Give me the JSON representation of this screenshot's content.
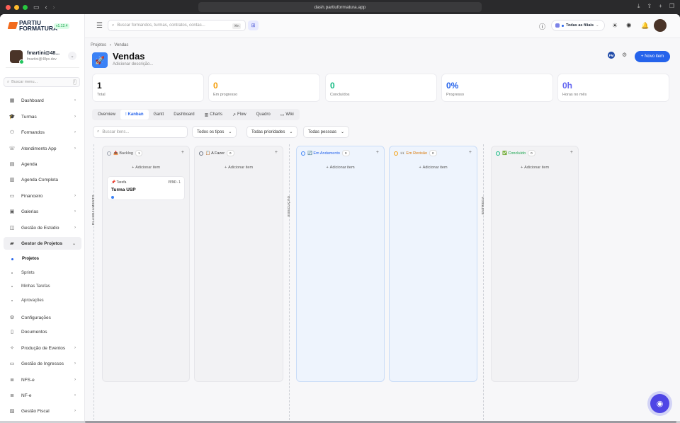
{
  "browser": {
    "url": "dash.partiuformatura.app"
  },
  "brand": {
    "line1": "PARTIU",
    "line2": "FORMATURA",
    "version": "v1.12.4"
  },
  "user": {
    "name": "fmartini@48...",
    "email": "fmartini@48px.dev"
  },
  "sidebar_search": {
    "placeholder": "Buscar menu...",
    "shortcut": "/"
  },
  "nav": [
    {
      "label": "Dashboard",
      "icon": "dashboard-icon",
      "chev": "›"
    },
    {
      "label": "Turmas",
      "icon": "graduation-cap-icon",
      "chev": "›"
    },
    {
      "label": "Formandos",
      "icon": "users-icon",
      "chev": "›"
    },
    {
      "label": "Atendimento App",
      "icon": "headset-icon",
      "chev": "›"
    },
    {
      "label": "Agenda",
      "icon": "calendar-icon",
      "chev": ""
    },
    {
      "label": "Agenda Completa",
      "icon": "calendar-full-icon",
      "chev": ""
    },
    {
      "label": "Financeiro",
      "icon": "wallet-icon",
      "chev": "›"
    },
    {
      "label": "Galerias",
      "icon": "gallery-icon",
      "chev": "›"
    },
    {
      "label": "Gestão de Estúdio",
      "icon": "studio-icon",
      "chev": "›"
    },
    {
      "label": "Gestor de Projetos",
      "icon": "briefcase-icon",
      "chev": "⌄"
    }
  ],
  "subnav": [
    {
      "label": "Projetos",
      "active": true
    },
    {
      "label": "Sprints"
    },
    {
      "label": "Minhas Tarefas"
    },
    {
      "label": "Aprovações"
    }
  ],
  "nav2": [
    {
      "label": "Configurações",
      "icon": "gear-icon",
      "chev": ""
    },
    {
      "label": "Documentos",
      "icon": "document-icon",
      "chev": ""
    },
    {
      "label": "Produção de Eventos",
      "icon": "event-icon",
      "chev": "›"
    },
    {
      "label": "Gestão de Ingressos",
      "icon": "ticket-icon",
      "chev": "›"
    },
    {
      "label": "NFS-e",
      "icon": "invoice-icon",
      "chev": "›"
    },
    {
      "label": "NF-e",
      "icon": "invoice-icon",
      "chev": "›"
    },
    {
      "label": "Gestão Fiscal",
      "icon": "fiscal-icon",
      "chev": "›"
    }
  ],
  "topbar": {
    "search_placeholder": "Buscar formandos, turmas, contratos, contas...",
    "search_shortcut": "⌘K",
    "branch_label": "Todas as filiais"
  },
  "page": {
    "breadcrumb": [
      "Projetos",
      "Vendas"
    ],
    "title": "Vendas",
    "description": "Adicionar descrição...",
    "member_initials": "FM",
    "new_button": "+ Novo item"
  },
  "stats": [
    {
      "value": "1",
      "label": "Total",
      "color": "#111111"
    },
    {
      "value": "0",
      "label": "Em progresso",
      "color": "#f59e0b"
    },
    {
      "value": "0",
      "label": "Concluídos",
      "color": "#10b981"
    },
    {
      "value": "0%",
      "label": "Progresso",
      "color": "#2563eb"
    },
    {
      "value": "0h",
      "label": "Horas no mês",
      "color": "#6366f1"
    }
  ],
  "tabs": [
    "Overview",
    "Kanban",
    "Gantt",
    "Dashboard",
    "Charts",
    "Flow",
    "Quadro",
    "Wiki"
  ],
  "filters": {
    "search_placeholder": "Buscar itens...",
    "type": "Todos os tipos",
    "priority": "Todas prioridades",
    "people": "Todas pessoas"
  },
  "phases": [
    "PLANEJAMENTO",
    "EXECUÇÃO",
    "ENTREGA"
  ],
  "columns": [
    {
      "title": "📥 Backlog",
      "count": "1",
      "ring": "#9ca3af",
      "bg": "#f2f2f4",
      "title_color": "#555555"
    },
    {
      "title": "📋 A Fazer",
      "count": "0",
      "ring": "#6b7280",
      "bg": "#f2f2f4",
      "title_color": "#333333"
    },
    {
      "title": "🔄 Em Andamento",
      "count": "0",
      "ring": "#3b82f6",
      "bg": "#eef4fd",
      "title_color": "#2563eb"
    },
    {
      "title": "👀 Em Revisão",
      "count": "0",
      "ring": "#f59e0b",
      "bg": "#eef4fd",
      "title_color": "#d97706"
    },
    {
      "title": "✅ Concluído",
      "count": "0",
      "ring": "#10b981",
      "bg": "#f2f2f4",
      "title_color": "#16a34a"
    }
  ],
  "add_item": "Adicionar item",
  "card": {
    "type": "📌 Tarefa",
    "code": "VEND-1",
    "title": "Turma USP"
  }
}
